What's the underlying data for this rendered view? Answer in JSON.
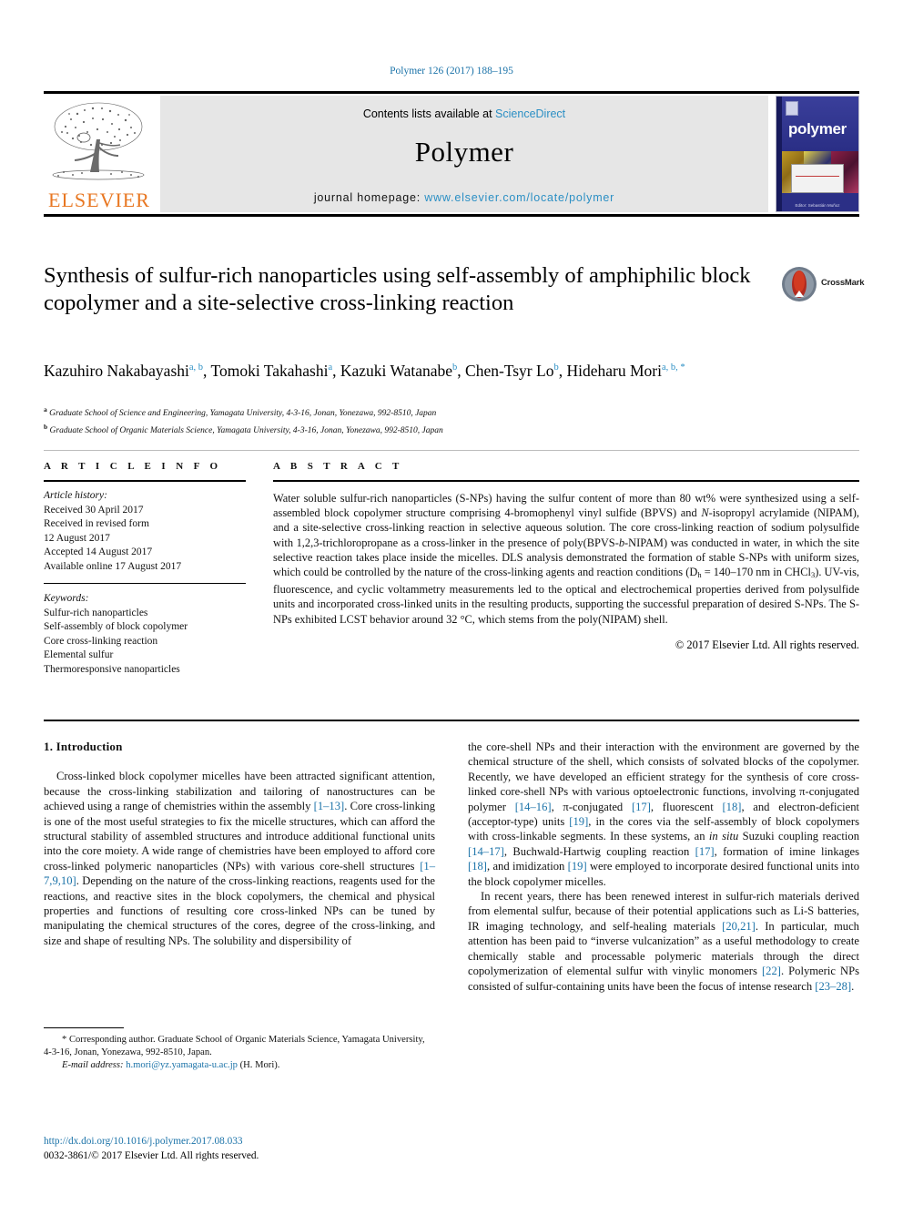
{
  "running_head": "Polymer 126 (2017) 188–195",
  "masthead": {
    "publisher_name": "ELSEVIER",
    "contents_prefix": "Contents lists available at ",
    "contents_link": "ScienceDirect",
    "journal_title": "Polymer",
    "homepage_label": "journal homepage: ",
    "homepage_url": "www.elsevier.com/locate/polymer",
    "cover_word": "polymer",
    "cover_footer": "Editor: Sebastián Muñoz"
  },
  "crossmark": {
    "label": "CrossMark"
  },
  "article": {
    "title": "Synthesis of sulfur-rich nanoparticles using self-assembly of amphiphilic block copolymer and a site-selective cross-linking reaction",
    "authors": [
      {
        "name": "Kazuhiro Nakabayashi",
        "marks": "a, b",
        "sep": ", "
      },
      {
        "name": "Tomoki Takahashi",
        "marks": "a",
        "sep": ", "
      },
      {
        "name": "Kazuki Watanabe",
        "marks": "b",
        "sep": ", "
      },
      {
        "name": "Chen-Tsyr Lo",
        "marks": "b",
        "sep": ", "
      },
      {
        "name": "Hideharu Mori",
        "marks": "a, b, *",
        "sep": ""
      }
    ],
    "affiliations": [
      {
        "mark": "a",
        "text": "Graduate School of Science and Engineering, Yamagata University, 4-3-16, Jonan, Yonezawa, 992-8510, Japan"
      },
      {
        "mark": "b",
        "text": "Graduate School of Organic Materials Science, Yamagata University, 4-3-16, Jonan, Yonezawa, 992-8510, Japan"
      }
    ]
  },
  "info": {
    "heading": "A R T I C L E   I N F O",
    "history_label": "Article history:",
    "history": [
      "Received 30 April 2017",
      "Received in revised form",
      "12 August 2017",
      "Accepted 14 August 2017",
      "Available online 17 August 2017"
    ],
    "keywords_label": "Keywords:",
    "keywords": [
      "Sulfur-rich nanoparticles",
      "Self-assembly of block copolymer",
      "Core cross-linking reaction",
      "Elemental sulfur",
      "Thermoresponsive nanoparticles"
    ]
  },
  "abstract": {
    "heading": "A B S T R A C T",
    "p1_a": "Water soluble sulfur-rich nanoparticles (S-NPs) having the sulfur content of more than 80 wt% were synthesized using a self-assembled block copolymer structure comprising 4-bromophenyl vinyl sulfide (BPVS) and ",
    "p1_italic_n": "N",
    "p1_b": "-isopropyl acrylamide (NIPAM), and a site-selective cross-linking reaction in selective aqueous solution. The core cross-linking reaction of sodium polysulfide with 1,2,3-trichloropropane as a cross-linker in the presence of poly(BPVS-",
    "p1_italic_b": "b",
    "p1_c": "-NIPAM) was conducted in water, in which the site selective reaction takes place inside the micelles. DLS analysis demonstrated the formation of stable S-NPs with uniform sizes, which could be controlled by the nature of the cross-linking agents and reaction conditions (D",
    "p1_sub_h": "h",
    "p1_d": " = 140–170 nm in CHCl",
    "p1_sub_3": "3",
    "p1_e": "). UV-vis, fluorescence, and cyclic voltammetry measurements led to the optical and electrochemical properties derived from polysulfide units and incorporated cross-linked units in the resulting products, supporting the successful preparation of desired S-NPs. The S-NPs exhibited LCST behavior around 32 °C, which stems from the poly(NIPAM) shell.",
    "copyright": "© 2017 Elsevier Ltd. All rights reserved."
  },
  "body": {
    "section_heading": "1. Introduction",
    "left_p1_a": "Cross-linked block copolymer micelles have been attracted significant attention, because the cross-linking stabilization and tailoring of nanostructures can be achieved using a range of chemistries within the assembly ",
    "left_p1_ref1": "[1–13]",
    "left_p1_b": ". Core cross-linking is one of the most useful strategies to fix the micelle structures, which can afford the structural stability of assembled structures and introduce additional functional units into the core moiety. A wide range of chemistries have been employed to afford core cross-linked polymeric nanoparticles (NPs) with various core-shell structures ",
    "left_p1_ref2": "[1–7,9,10]",
    "left_p1_c": ". Depending on the nature of the cross-linking reactions, reagents used for the reactions, and reactive sites in the block copolymers, the chemical and physical properties and functions of resulting core cross-linked NPs can be tuned by manipulating the chemical structures of the cores, degree of the cross-linking, and size and shape of resulting NPs. The solubility and dispersibility of",
    "right_p1_a": "the core-shell NPs and their interaction with the environment are governed by the chemical structure of the shell, which consists of solvated blocks of the copolymer. Recently, we have developed an efficient strategy for the synthesis of core cross-linked core-shell NPs with various optoelectronic functions, involving π-conjugated polymer ",
    "right_p1_ref1": "[14–16]",
    "right_p1_b": ", π-conjugated ",
    "right_p1_ref2": "[17]",
    "right_p1_c": ", fluorescent ",
    "right_p1_ref3": "[18]",
    "right_p1_d": ", and electron-deficient (acceptor-type) units ",
    "right_p1_ref4": "[19]",
    "right_p1_e": ", in the cores via the self-assembly of block copolymers with cross-linkable segments. In these systems, an ",
    "right_p1_italic": "in situ",
    "right_p1_f": " Suzuki coupling reaction ",
    "right_p1_ref5": "[14–17]",
    "right_p1_g": ", Buchwald-Hartwig coupling reaction ",
    "right_p1_ref6": "[17]",
    "right_p1_h": ", formation of imine linkages ",
    "right_p1_ref7": "[18]",
    "right_p1_i": ", and imidization ",
    "right_p1_ref8": "[19]",
    "right_p1_j": " were employed to incorporate desired functional units into the block copolymer micelles.",
    "right_p2_a": "In recent years, there has been renewed interest in sulfur-rich materials derived from elemental sulfur, because of their potential applications such as Li-S batteries, IR imaging technology, and self-healing materials ",
    "right_p2_ref1": "[20,21]",
    "right_p2_b": ". In particular, much attention has been paid to “inverse vulcanization” as a useful methodology to create chemically stable and processable polymeric materials through the direct copolymerization of elemental sulfur with vinylic monomers ",
    "right_p2_ref2": "[22]",
    "right_p2_c": ". Polymeric NPs consisted of sulfur-containing units have been the focus of intense research ",
    "right_p2_ref3": "[23–28]",
    "right_p2_d": "."
  },
  "footnote": {
    "star": "*",
    "corresponding": " Corresponding author. Graduate School of Organic Materials Science, Yamagata University, 4-3-16, Jonan, Yonezawa, 992-8510, Japan.",
    "email_label": "E-mail address:",
    "email": "h.mori@yz.yamagata-u.ac.jp",
    "email_suffix": " (H. Mori)."
  },
  "doi_block": {
    "doi": "http://dx.doi.org/10.1016/j.polymer.2017.08.033",
    "issn_copyright": "0032-3861/© 2017 Elsevier Ltd. All rights reserved."
  },
  "colors": {
    "link_blue": "#1a72a8",
    "sciencedirect_blue": "#2b8fc4",
    "elsevier_orange": "#E87722",
    "banner_gray": "#e6e6e6",
    "cover_navy": "#2b2f86"
  }
}
